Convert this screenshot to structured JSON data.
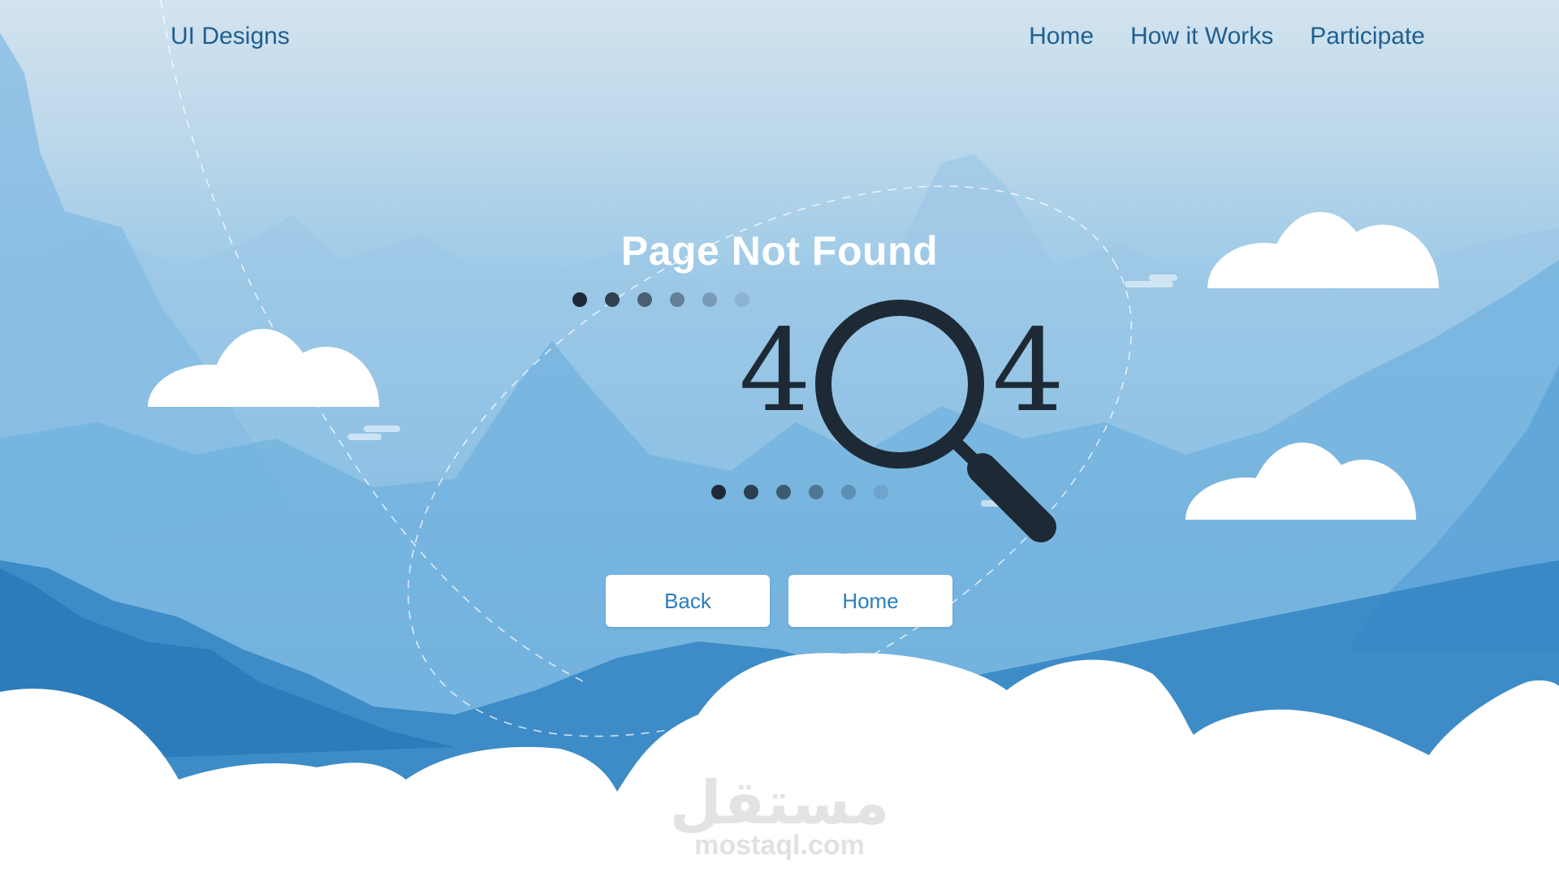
{
  "header": {
    "brand": "UI Designs",
    "nav": [
      {
        "label": "Home"
      },
      {
        "label": "How it Works"
      },
      {
        "label": "Participate"
      }
    ]
  },
  "main": {
    "title": "Page Not Found",
    "code_left": "4",
    "code_right": "4",
    "icons": [
      "magnifier-icon"
    ],
    "buttons": {
      "back": "Back",
      "home": "Home"
    }
  },
  "watermark": {
    "arabic": "مستقل",
    "site": "mostaql.com"
  },
  "colors": {
    "nav_text": "#1f5f92",
    "sky_top": "#d3e3ee",
    "sky_bottom": "#2f86c8",
    "icon_dark": "#1d2a36",
    "button_text": "#2a7fc0",
    "cloud": "#ffffff"
  }
}
